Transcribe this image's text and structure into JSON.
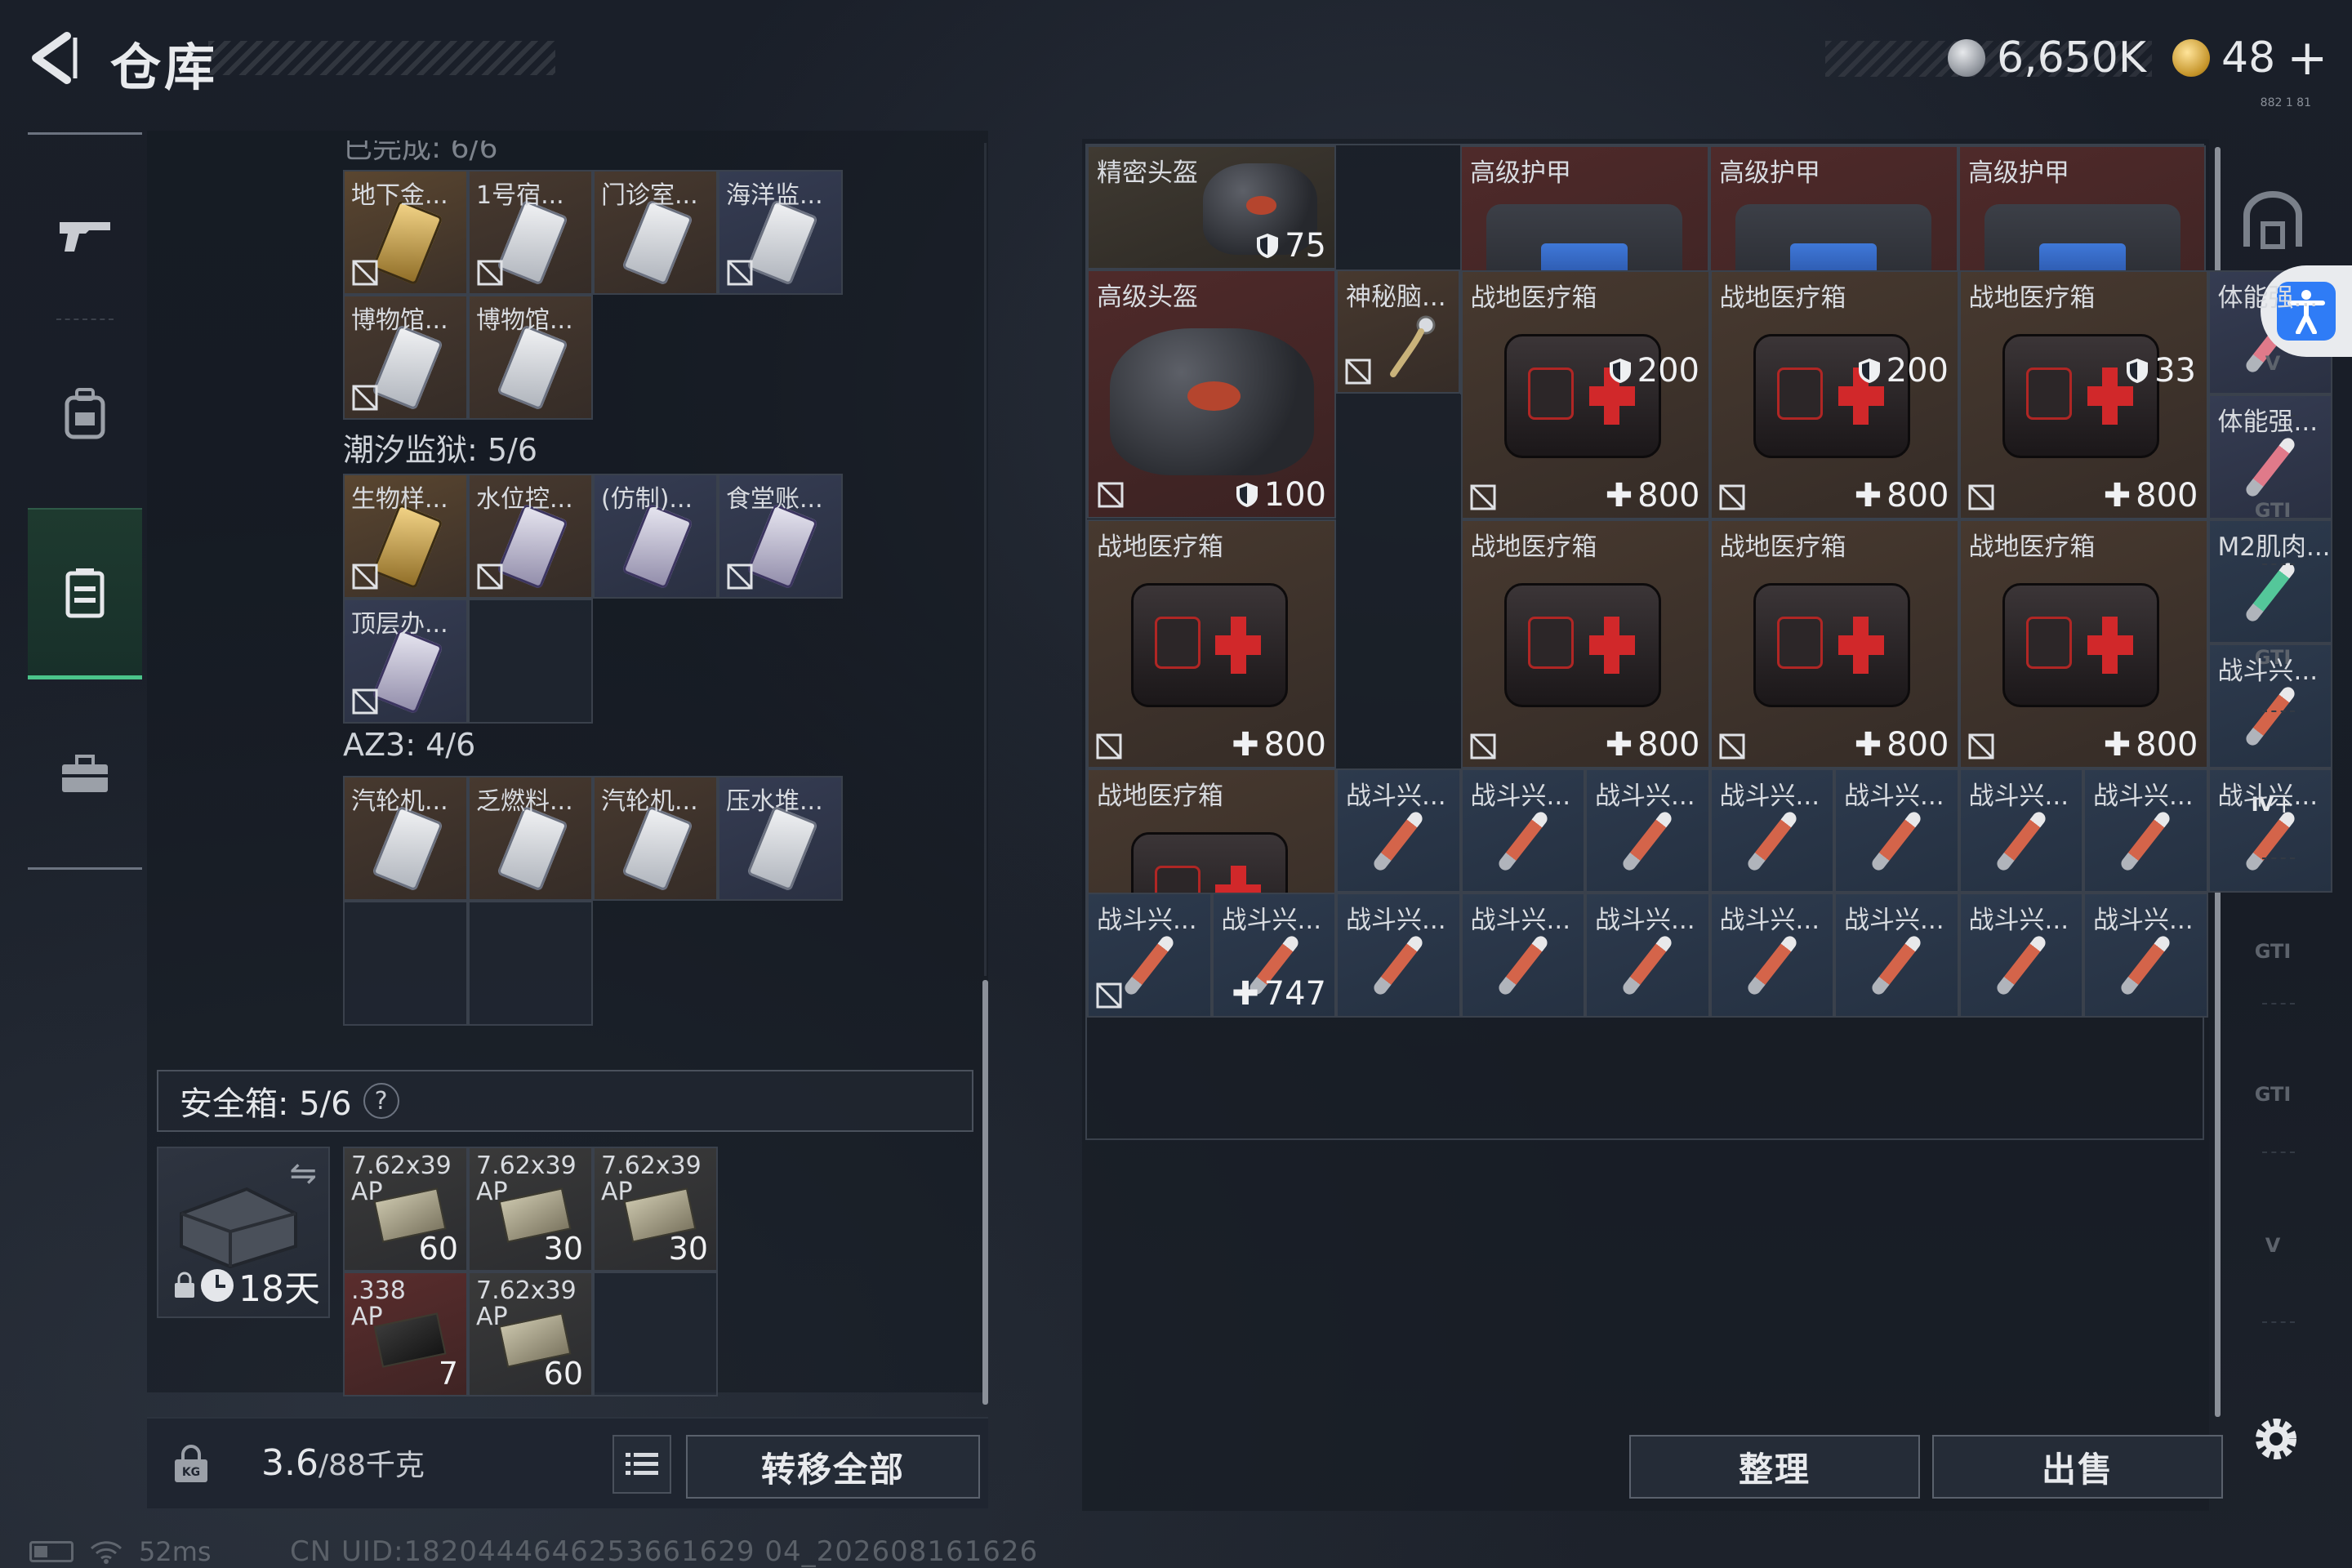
{
  "header": {
    "title": "仓库",
    "silver_amount": "6,650K",
    "gold_amount": "48",
    "gold_plus": "+",
    "tiny_label": "882 1 81"
  },
  "leftnav": {
    "items": [
      "weapon",
      "backpack",
      "container",
      "toolbox"
    ],
    "active": "container"
  },
  "left_container": {
    "cutoff_label": "已完成: 6/6",
    "sections": [
      {
        "label": "潮汐监狱: 5/6",
        "cells": [
          "生物样...",
          "水位控...",
          "(仿制)...",
          "食堂账...",
          "顶层办..."
        ]
      },
      {
        "label": "AZ3: 4/6",
        "cells": [
          "汽轮机...",
          "乏燃料...",
          "汽轮机...",
          "压水堆..."
        ]
      }
    ],
    "top_cells": [
      "地下金...",
      "1号宿...",
      "门诊室...",
      "海洋监...",
      "博物馆...",
      "博物馆..."
    ]
  },
  "safebox": {
    "label": "安全箱: 5/6",
    "help": "?",
    "days": "18天",
    "ammo": [
      {
        "line1": "7.62x39",
        "line2": "AP",
        "count": "60"
      },
      {
        "line1": "7.62x39",
        "line2": "AP",
        "count": "30"
      },
      {
        "line1": "7.62x39",
        "line2": "AP",
        "count": "30"
      },
      {
        "line1": ".338",
        "line2": "AP",
        "count": "7"
      },
      {
        "line1": "7.62x39",
        "line2": "AP",
        "count": "60"
      }
    ]
  },
  "bottom_left": {
    "weight": "3.6",
    "weight_total": "/88千克",
    "transfer_label": "转移全部"
  },
  "stash": {
    "items": {
      "precision_helmet": {
        "name": "精密头盔",
        "value": "75"
      },
      "armor1": {
        "name": "高级护甲",
        "value": "200"
      },
      "armor2": {
        "name": "高级护甲",
        "value": "200"
      },
      "armor3": {
        "name": "高级护甲",
        "value": "33"
      },
      "adv_helmet": {
        "name": "高级头盔",
        "value": "100"
      },
      "mystery": {
        "name": "神秘脑..."
      },
      "medkit_name": "战地医疗箱",
      "medkit_value": "800",
      "medkit_last_value": "747",
      "stim1": "体能强...",
      "stim2": "体能强...",
      "m2": "M2肌肉...",
      "combat": "战斗兴..."
    },
    "sort_label": "整理",
    "sell_label": "出售"
  },
  "right_tabs": [
    "V",
    "GTI",
    "GTI",
    "IV",
    "GTI",
    "GTI",
    "V"
  ],
  "status": {
    "ping": "52ms",
    "uid": "CN UID:1820444646253661629 04_202608161626"
  }
}
